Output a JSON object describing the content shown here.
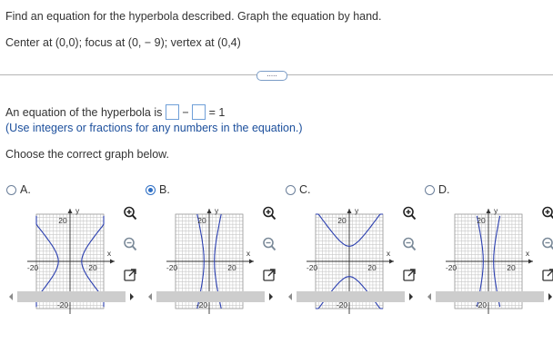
{
  "question": {
    "prompt": "Find an equation for the hyperbola described. Graph the equation by hand.",
    "given": "Center at (0,0); focus at (0, − 9); vertex at (0,4)"
  },
  "expand_button": {
    "label": "....."
  },
  "answer": {
    "lead": "An equation of the hyperbola is",
    "minus": "−",
    "equals": "= 1",
    "hint": "(Use integers or fractions for any numbers in the equation.)"
  },
  "choose_prompt": "Choose the correct graph below.",
  "options": [
    {
      "letter": "A.",
      "selected": false,
      "orientation": "horizontal"
    },
    {
      "letter": "B.",
      "selected": true,
      "orientation": "vertical-near"
    },
    {
      "letter": "C.",
      "selected": false,
      "orientation": "vertical"
    },
    {
      "letter": "D.",
      "selected": false,
      "orientation": "horizontal-flat"
    }
  ],
  "graph_labels": {
    "y": "y",
    "x": "x",
    "top": "20",
    "bottom": "-20",
    "left": "-20",
    "right": "20"
  },
  "tools": {
    "zoom_in": "zoom-in-icon",
    "zoom_out": "zoom-out-icon",
    "popout": "popout-icon"
  },
  "colors": {
    "curve": "#2b3fb0",
    "accent": "#2f6fc4",
    "grid": "#c8c8c8"
  }
}
